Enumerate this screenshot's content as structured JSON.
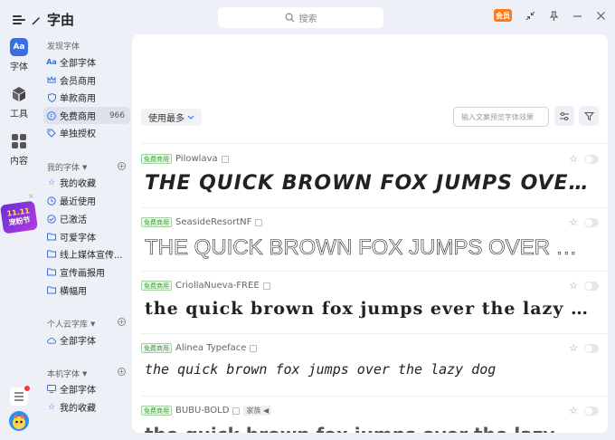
{
  "app": {
    "title": "字由"
  },
  "search": {
    "placeholder": "搜索"
  },
  "titlebar": {
    "member_badge": "会员"
  },
  "rail": {
    "items": [
      {
        "label": "字体",
        "icon": "font-aa-icon"
      },
      {
        "label": "工具",
        "icon": "cube-icon"
      },
      {
        "label": "内容",
        "icon": "grid-icon"
      }
    ],
    "promo": {
      "line1": "11.11",
      "line2": "宠粉节"
    }
  },
  "sidebar": {
    "discover": {
      "title": "发现字体",
      "items": [
        {
          "label": "全部字体",
          "icon": "Aa"
        },
        {
          "label": "会员商用",
          "icon": "crown"
        },
        {
          "label": "单款商用",
          "icon": "shield"
        },
        {
          "label": "免费商用",
          "icon": "free",
          "count": "966",
          "active": true
        },
        {
          "label": "单独授权",
          "icon": "tag"
        }
      ]
    },
    "my_fonts": {
      "title": "我的字体",
      "items": [
        {
          "label": "我的收藏"
        },
        {
          "label": "最近使用"
        },
        {
          "label": "已激活"
        },
        {
          "label": "可爱字体"
        },
        {
          "label": "线上媒体宣传..."
        },
        {
          "label": "宣传画报用"
        },
        {
          "label": "横幅用"
        }
      ]
    },
    "cloud": {
      "title": "个人云字库",
      "items": [
        {
          "label": "全部字体"
        }
      ]
    },
    "local": {
      "title": "本机字体",
      "items": [
        {
          "label": "全部字体"
        },
        {
          "label": "我的收藏"
        }
      ]
    }
  },
  "main": {
    "sort_label": "使用最多",
    "preview_placeholder": "输入文案预览字体效果",
    "fonts": [
      {
        "badge": "免费商用",
        "name": "Pilowlava",
        "sample": "THE QUICK BROWN FOX JUMPS OVER."
      },
      {
        "badge": "免费商用",
        "name": "SeasideResortNF",
        "sample": "THE QUICK BROWN FOX JUMPS OVER THE ..."
      },
      {
        "badge": "免费商用",
        "name": "CriollaNueva-FREE",
        "sample": "the quick brown fox jumps ever the lazy deg"
      },
      {
        "badge": "免费商用",
        "name": "Alinea Typeface",
        "sample": "the quick brown fox jumps over the lazy dog"
      },
      {
        "badge": "免费商用",
        "name": "BUBU-BOLD",
        "family_tag": "家族",
        "sample": "the quick brown fox jumps over the lazy dog"
      }
    ]
  },
  "colors": {
    "accent": "#3b6fe0",
    "member": "#ff7a1a",
    "free_badge": "#3a9e3a",
    "bg": "#eef0f8"
  }
}
